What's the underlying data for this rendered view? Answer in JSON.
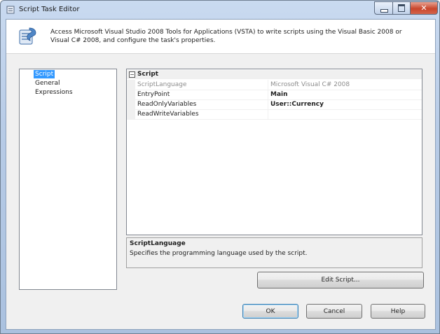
{
  "window": {
    "title": "Script Task Editor",
    "controls": {
      "minimize_icon": "minimize-icon",
      "maximize_icon": "maximize-icon",
      "close_glyph": "✕"
    }
  },
  "header": {
    "icon": "script-task-icon",
    "description": "Access Microsoft Visual Studio 2008 Tools for Applications (VSTA) to write scripts using the Visual Basic 2008 or Visual C# 2008, and configure the task's properties."
  },
  "nav": {
    "items": [
      {
        "label": "Script",
        "selected": true
      },
      {
        "label": "General",
        "selected": false
      },
      {
        "label": "Expressions",
        "selected": false
      }
    ]
  },
  "grid": {
    "category": {
      "toggle": "⊟",
      "label": "Script"
    },
    "properties": [
      {
        "name": "ScriptLanguage",
        "value": "Microsoft Visual C# 2008",
        "readonly": true
      },
      {
        "name": "EntryPoint",
        "value": "Main",
        "readonly": false
      },
      {
        "name": "ReadOnlyVariables",
        "value": "User::Currency",
        "readonly": false
      },
      {
        "name": "ReadWriteVariables",
        "value": "",
        "readonly": false
      }
    ]
  },
  "help": {
    "title": "ScriptLanguage",
    "description": "Specifies the programming language used by the script."
  },
  "buttons": {
    "edit_script": "Edit Script...",
    "ok": "OK",
    "cancel": "Cancel",
    "help": "Help"
  },
  "colors": {
    "selection": "#3399ff",
    "close_button": "#c9462c",
    "accent_border": "#3c7fb1"
  }
}
